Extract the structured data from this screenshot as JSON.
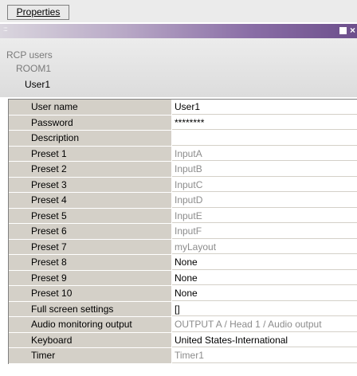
{
  "toolbar": {
    "tab_label": "Properties"
  },
  "titlebar": {
    "grip": "::::",
    "close": "×"
  },
  "tree": {
    "root": "RCP users",
    "child": "ROOM1",
    "leaf": "User1"
  },
  "rows": [
    {
      "label": "User name",
      "value": "User1",
      "dim": false
    },
    {
      "label": "Password",
      "value": "********",
      "dim": false
    },
    {
      "label": "Description",
      "value": "",
      "dim": false
    },
    {
      "label": "Preset 1",
      "value": "InputA",
      "dim": true
    },
    {
      "label": "Preset 2",
      "value": "InputB",
      "dim": true
    },
    {
      "label": "Preset 3",
      "value": "InputC",
      "dim": true
    },
    {
      "label": "Preset 4",
      "value": "InputD",
      "dim": true
    },
    {
      "label": "Preset 5",
      "value": "InputE",
      "dim": true
    },
    {
      "label": "Preset 6",
      "value": "InputF",
      "dim": true
    },
    {
      "label": "Preset 7",
      "value": "myLayout",
      "dim": true
    },
    {
      "label": "Preset 8",
      "value": "None",
      "dim": false
    },
    {
      "label": "Preset 9",
      "value": "None",
      "dim": false
    },
    {
      "label": "Preset 10",
      "value": "None",
      "dim": false
    },
    {
      "label": "Full screen settings",
      "value": "[]",
      "dim": false
    },
    {
      "label": "Audio monitoring output",
      "value": "OUTPUT A / Head 1 / Audio output",
      "dim": true
    },
    {
      "label": "Keyboard",
      "value": "United States-International",
      "dim": false
    },
    {
      "label": "Timer",
      "value": "Timer1",
      "dim": true
    }
  ]
}
